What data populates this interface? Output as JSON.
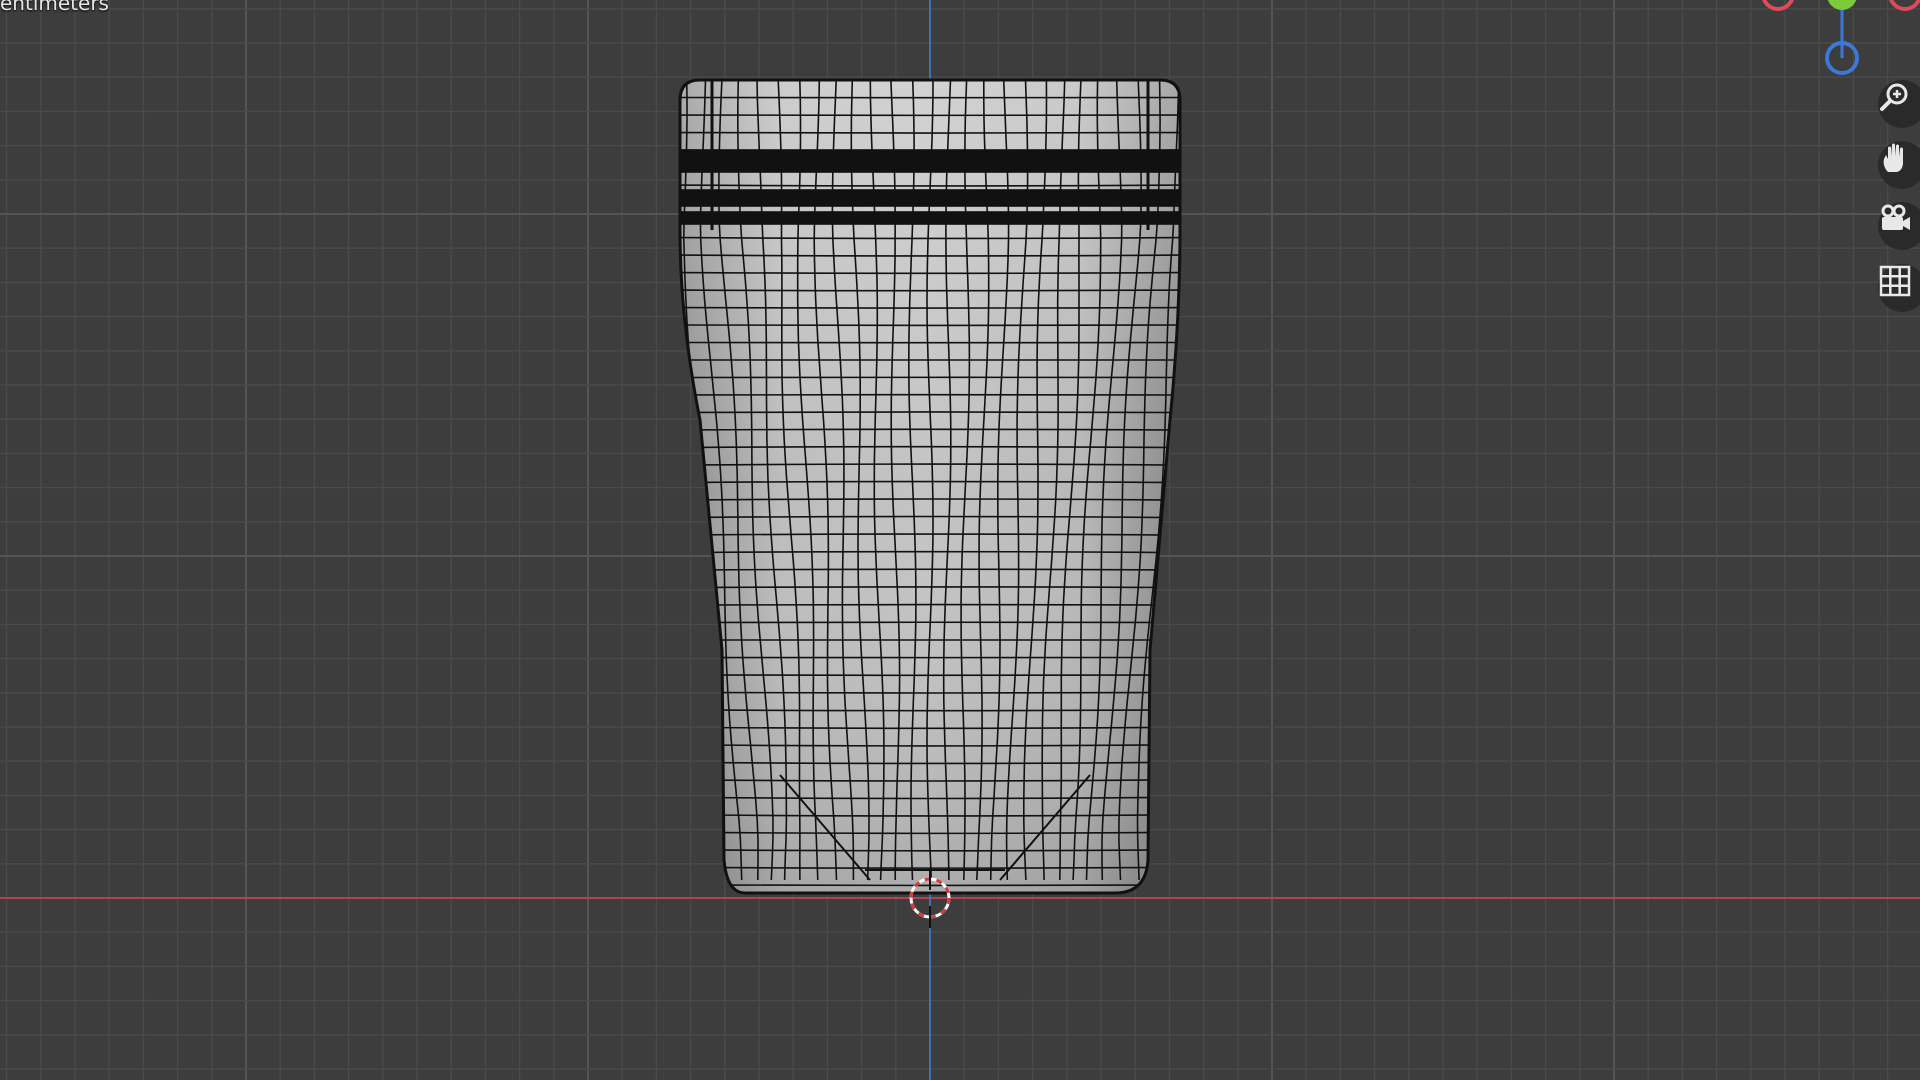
{
  "viewport": {
    "unit_label": "entimeters",
    "background": "#3d3d3d",
    "grid_minor_color": "#4a4a4a",
    "grid_major_color": "#555555",
    "x_axis_color": "#b8404f",
    "z_axis_color": "#3f72b3",
    "mesh_fill": "#c4c4c4",
    "wire_color": "#111111"
  },
  "gizmo": {
    "x_color": "#e04a5a",
    "y_color": "#7bcb3b",
    "z_color": "#3c78d8"
  },
  "nav_buttons": [
    {
      "name": "zoom-icon"
    },
    {
      "name": "pan-hand-icon"
    },
    {
      "name": "camera-icon"
    },
    {
      "name": "grid-view-icon"
    }
  ]
}
